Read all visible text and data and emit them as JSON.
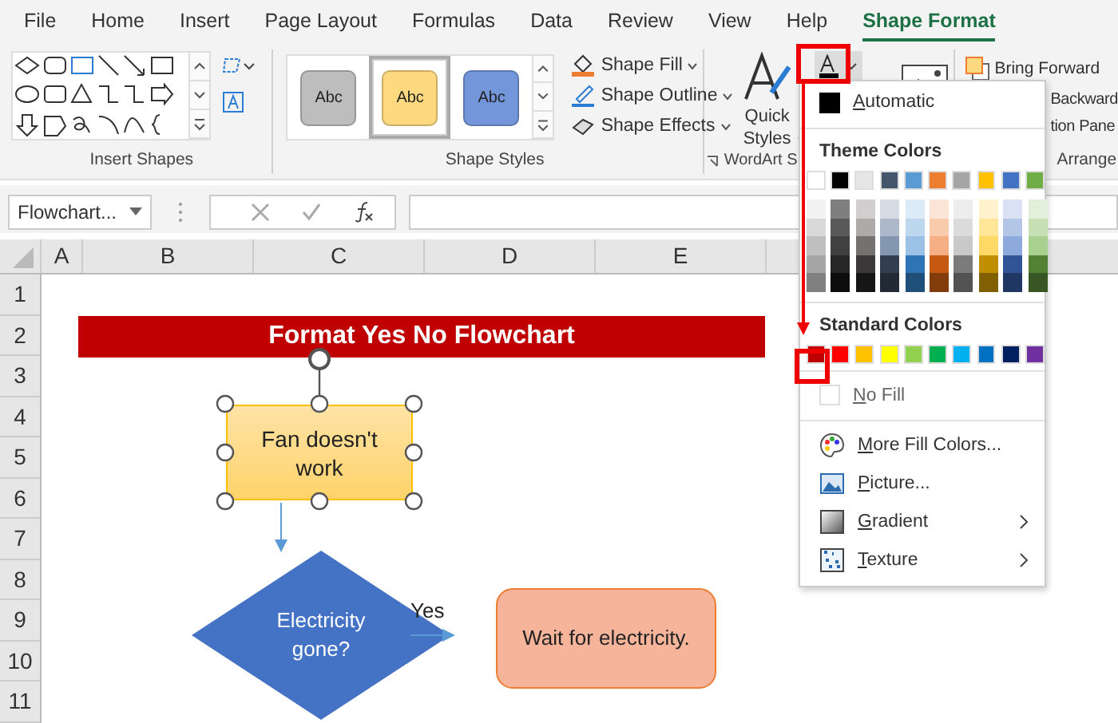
{
  "tabs": [
    {
      "label": "File",
      "selected": false
    },
    {
      "label": "Home",
      "selected": false
    },
    {
      "label": "Insert",
      "selected": false
    },
    {
      "label": "Page Layout",
      "selected": false
    },
    {
      "label": "Formulas",
      "selected": false
    },
    {
      "label": "Data",
      "selected": false
    },
    {
      "label": "Review",
      "selected": false
    },
    {
      "label": "View",
      "selected": false
    },
    {
      "label": "Help",
      "selected": false
    },
    {
      "label": "Shape Format",
      "selected": true
    }
  ],
  "ribbon": {
    "insert_shapes": {
      "label": "Insert Shapes"
    },
    "shape_styles": {
      "label": "Shape Styles",
      "styles": [
        {
          "label": "Abc",
          "color": "#bdbdbd",
          "selected": false
        },
        {
          "label": "Abc",
          "color": "#ffd97f",
          "selected": true
        },
        {
          "label": "Abc",
          "color": "#7396da",
          "selected": false
        }
      ],
      "commands": [
        "Shape Fill",
        "Shape Outline",
        "Shape Effects"
      ]
    },
    "wordart": {
      "label": "WordArt S",
      "quick_styles": "Quick Styles"
    },
    "arrange": {
      "label": "Arrange",
      "commands": [
        "Bring Forward",
        "Backward",
        "tion Pane"
      ]
    }
  },
  "formula_bar": {
    "name_box": "Flowchart..."
  },
  "sheet": {
    "columns": [
      "A",
      "B",
      "C",
      "D",
      "E"
    ],
    "rows": [
      "1",
      "2",
      "3",
      "4",
      "5",
      "6",
      "7",
      "8",
      "9",
      "10",
      "11"
    ]
  },
  "flowchart": {
    "title": "Format Yes No Flowchart",
    "edge_label": "Yes",
    "nodes": [
      {
        "kind": "process",
        "text": "Fan doesn't work",
        "selected": true
      },
      {
        "kind": "decision",
        "text": "Electricity gone?",
        "selected": false
      },
      {
        "kind": "terminal",
        "text": "Wait for electricity.",
        "selected": false
      }
    ]
  },
  "color_menu": {
    "automatic": "Automatic",
    "theme_heading": "Theme Colors",
    "standard_heading": "Standard Colors",
    "theme_colors": [
      {
        "color": "#ffffff",
        "shades": [
          {
            "color": "#f2f2f2"
          },
          {
            "color": "#d9d9d9"
          },
          {
            "color": "#bfbfbf"
          },
          {
            "color": "#a6a6a6"
          },
          {
            "color": "#808080"
          }
        ]
      },
      {
        "color": "#000000",
        "shades": [
          {
            "color": "#7f7f7f"
          },
          {
            "color": "#595959"
          },
          {
            "color": "#404040"
          },
          {
            "color": "#262626"
          },
          {
            "color": "#0d0d0d"
          }
        ]
      },
      {
        "color": "#e7e6e6",
        "shades": [
          {
            "color": "#d0cece"
          },
          {
            "color": "#aeaaaa"
          },
          {
            "color": "#757171"
          },
          {
            "color": "#3a3838"
          },
          {
            "color": "#171616"
          }
        ]
      },
      {
        "color": "#44546a",
        "shades": [
          {
            "color": "#d6dce4"
          },
          {
            "color": "#adb9ca"
          },
          {
            "color": "#8497b0"
          },
          {
            "color": "#333f4f"
          },
          {
            "color": "#222b35"
          }
        ]
      },
      {
        "color": "#5b9bd5",
        "shades": [
          {
            "color": "#ddebf7"
          },
          {
            "color": "#bdd7ee"
          },
          {
            "color": "#9bc2e6"
          },
          {
            "color": "#2f75b5"
          },
          {
            "color": "#1f4e78"
          }
        ]
      },
      {
        "color": "#ed7d31",
        "shades": [
          {
            "color": "#fce4d6"
          },
          {
            "color": "#f8cbad"
          },
          {
            "color": "#f4b084"
          },
          {
            "color": "#c65911"
          },
          {
            "color": "#833c0c"
          }
        ]
      },
      {
        "color": "#a5a5a5",
        "shades": [
          {
            "color": "#ededed"
          },
          {
            "color": "#dbdbdb"
          },
          {
            "color": "#c9c9c9"
          },
          {
            "color": "#7b7b7b"
          },
          {
            "color": "#525252"
          }
        ]
      },
      {
        "color": "#ffc000",
        "shades": [
          {
            "color": "#fff2cc"
          },
          {
            "color": "#ffe699"
          },
          {
            "color": "#ffd966"
          },
          {
            "color": "#bf8f00"
          },
          {
            "color": "#806000"
          }
        ]
      },
      {
        "color": "#4472c4",
        "shades": [
          {
            "color": "#d9e1f2"
          },
          {
            "color": "#b4c6e7"
          },
          {
            "color": "#8ea9db"
          },
          {
            "color": "#305496"
          },
          {
            "color": "#203764"
          }
        ]
      },
      {
        "color": "#70ad47",
        "shades": [
          {
            "color": "#e2efda"
          },
          {
            "color": "#c6e0b4"
          },
          {
            "color": "#a9d08e"
          },
          {
            "color": "#548235"
          },
          {
            "color": "#375623"
          }
        ]
      }
    ],
    "standard_colors": [
      {
        "color": "#c00000"
      },
      {
        "color": "#ff0000"
      },
      {
        "color": "#ffc000"
      },
      {
        "color": "#ffff00"
      },
      {
        "color": "#92d050"
      },
      {
        "color": "#00b050"
      },
      {
        "color": "#00b0f0"
      },
      {
        "color": "#0070c0"
      },
      {
        "color": "#002060"
      },
      {
        "color": "#7030a0"
      }
    ],
    "no_fill": "No Fill",
    "items": [
      {
        "kind": "palette",
        "label": "More Fill Colors...",
        "submenu": false
      },
      {
        "kind": "picture",
        "label": "Picture...",
        "submenu": false
      },
      {
        "kind": "gradient",
        "label": "Gradient",
        "submenu": true
      },
      {
        "kind": "texture",
        "label": "Texture",
        "submenu": true
      }
    ]
  }
}
